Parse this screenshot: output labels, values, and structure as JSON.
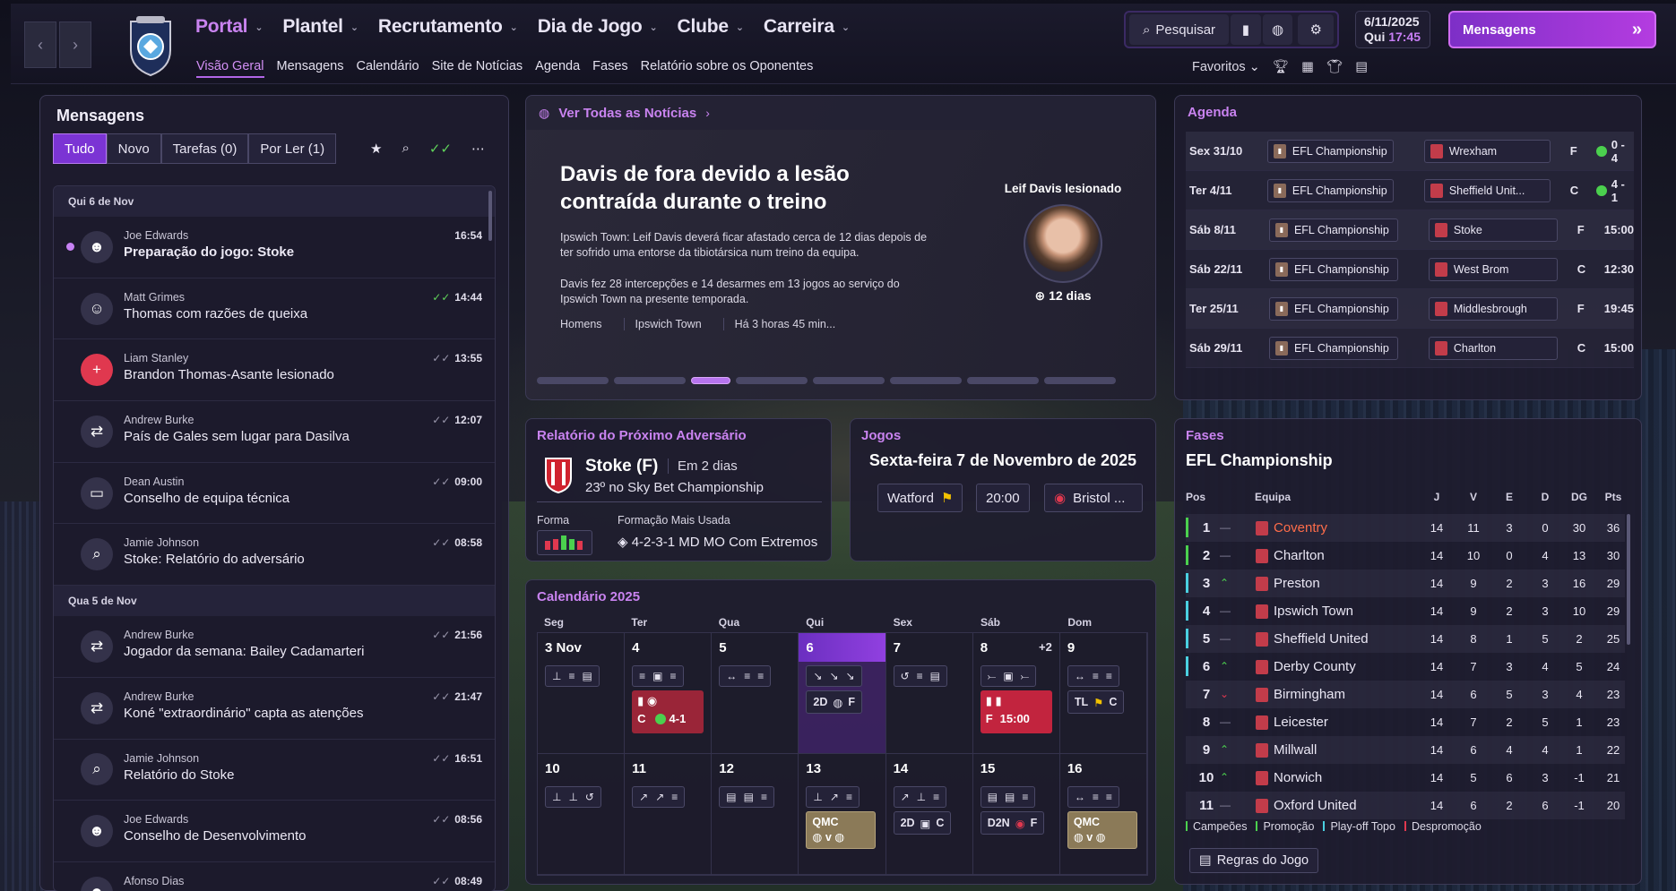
{
  "nav": {
    "back": "‹",
    "forward": "›"
  },
  "menu": [
    {
      "label": "Portal",
      "active": true
    },
    {
      "label": "Plantel"
    },
    {
      "label": "Recrutamento"
    },
    {
      "label": "Dia de Jogo"
    },
    {
      "label": "Clube"
    },
    {
      "label": "Carreira"
    }
  ],
  "submenu": [
    "Visão Geral",
    "Mensagens",
    "Calendário",
    "Site de Notícias",
    "Agenda",
    "Fases",
    "Relatório sobre os Oponentes"
  ],
  "tools": {
    "search": "Pesquisar"
  },
  "datetime": {
    "date": "6/11/2025",
    "day": "Qui",
    "time": "17:45"
  },
  "messages_button": "Mensagens",
  "favourites": "Favoritos",
  "inbox": {
    "title": "Mensagens",
    "filters": [
      "Tudo",
      "Novo",
      "Tarefas (0)",
      "Por Ler (1)"
    ],
    "groups": [
      {
        "date": "Qui 6 de Nov",
        "items": [
          {
            "from": "Joe Edwards",
            "subject": "Preparação do jogo: Stoke",
            "time": "16:54",
            "unread": true,
            "icon": "people-icon"
          },
          {
            "from": "Matt Grimes",
            "subject": "Thomas com razões de queixa",
            "time": "14:44",
            "read": "green",
            "icon": "player-photo"
          },
          {
            "from": "Liam Stanley",
            "subject": "Brandon Thomas-Asante lesionado",
            "time": "13:55",
            "icon": "medical-icon"
          },
          {
            "from": "Andrew Burke",
            "subject": "País de Gales sem lugar para Dasilva",
            "time": "12:07",
            "icon": "transfer-icon"
          },
          {
            "from": "Dean Austin",
            "subject": "Conselho de equipa técnica",
            "time": "09:00",
            "icon": "briefcase-icon"
          },
          {
            "from": "Jamie Johnson",
            "subject": "Stoke: Relatório do adversário",
            "time": "08:58",
            "icon": "scout-icon"
          }
        ]
      },
      {
        "date": "Qua 5 de Nov",
        "items": [
          {
            "from": "Andrew Burke",
            "subject": "Jogador da semana: Bailey Cadamarteri",
            "time": "21:56",
            "icon": "transfer-icon"
          },
          {
            "from": "Andrew Burke",
            "subject": "Koné \"extraordinário\" capta as atenções",
            "time": "21:47",
            "icon": "transfer-icon"
          },
          {
            "from": "Jamie Johnson",
            "subject": "Relatório do Stoke",
            "time": "16:51",
            "icon": "scout-icon"
          },
          {
            "from": "Joe Edwards",
            "subject": "Conselho de Desenvolvimento",
            "time": "08:56",
            "icon": "people-icon"
          },
          {
            "from": "Afonso Dias",
            "subject": "",
            "time": "08:49",
            "icon": "people-icon"
          }
        ]
      }
    ]
  },
  "news": {
    "link": "Ver Todas as Notícias",
    "headline": "Davis de fora devido a lesão contraída durante o treino",
    "p1": "Ipswich Town: Leif Davis deverá ficar afastado cerca de 12 dias depois de ter sofrido uma entorse da tibiotársica num treino da equipa.",
    "p2": "Davis fez 28 intercepções e 14 desarmes em 13 jogos ao serviço do Ipswich Town na presente temporada.",
    "tags": [
      "Homens",
      "Ipswich Town",
      "Há 3 horas 45 min..."
    ],
    "injury_title": "Leif Davis lesionado",
    "injury_days": "12 dias",
    "active_page": 3,
    "pages": 8
  },
  "agenda": {
    "title": "Agenda",
    "rows": [
      {
        "date": "Sex 31/10",
        "comp": "EFL Championship",
        "opp": "Wrexham",
        "ha": "F",
        "result": "0 - 4",
        "win": true
      },
      {
        "date": "Ter 4/11",
        "comp": "EFL Championship",
        "opp": "Sheffield Unit...",
        "ha": "C",
        "result": "4 - 1",
        "win": true
      },
      {
        "date": "Sáb 8/11",
        "comp": "EFL Championship",
        "opp": "Stoke",
        "ha": "F",
        "result": "15:00"
      },
      {
        "date": "Sáb 22/11",
        "comp": "EFL Championship",
        "opp": "West Brom",
        "ha": "C",
        "result": "12:30"
      },
      {
        "date": "Ter 25/11",
        "comp": "EFL Championship",
        "opp": "Middlesbrough",
        "ha": "F",
        "result": "19:45"
      },
      {
        "date": "Sáb 29/11",
        "comp": "EFL Championship",
        "opp": "Charlton",
        "ha": "C",
        "result": "15:00"
      }
    ]
  },
  "opponent": {
    "title": "Relatório do Próximo Adversário",
    "team": "Stoke (F)",
    "in": "Em 2 dias",
    "position": "23º no Sky Bet Championship",
    "form_label": "Forma",
    "formation_label": "Formação Mais Usada",
    "formation": "4-2-3-1 MD MO Com Extremos"
  },
  "jogos": {
    "title": "Jogos",
    "date": "Sexta-feira 7 de Novembro de 2025",
    "home": "Watford",
    "time": "20:00",
    "away": "Bristol ..."
  },
  "calendar": {
    "title": "Calendário 2025",
    "weekdays": [
      "Seg",
      "Ter",
      "Qua",
      "Qui",
      "Sex",
      "Sáb",
      "Dom"
    ],
    "week1": [
      "3 Nov",
      "4",
      "5",
      "6",
      "7",
      "8",
      "9"
    ],
    "week2": [
      "10",
      "11",
      "12",
      "13",
      "14",
      "15",
      "16"
    ],
    "extra": "+2",
    "tue_result": "4-1",
    "sat_time": "15:00",
    "sat_ha": "F",
    "tue_ha": "C",
    "thu_row": [
      "2D",
      "F"
    ],
    "sun_row": [
      "TL",
      "C"
    ],
    "fri2": [
      "2D",
      "C"
    ],
    "sat2": [
      "D2N",
      "F"
    ],
    "qmc": "QMC",
    "v": "v"
  },
  "fases": {
    "title": "Fases",
    "league": "EFL Championship",
    "cols": [
      "Pos",
      "Equipa",
      "J",
      "V",
      "E",
      "D",
      "DG",
      "Pts"
    ],
    "rows": [
      {
        "pos": "1",
        "mv": "—",
        "team": "Coventry",
        "j": 14,
        "v": 11,
        "e": 3,
        "d": 0,
        "dg": 30,
        "pts": 36,
        "zone": "champ",
        "hl": true
      },
      {
        "pos": "2",
        "mv": "—",
        "team": "Charlton",
        "j": 14,
        "v": 10,
        "e": 0,
        "d": 4,
        "dg": 13,
        "pts": 30,
        "zone": "promo"
      },
      {
        "pos": "3",
        "mv": "^",
        "team": "Preston",
        "j": 14,
        "v": 9,
        "e": 2,
        "d": 3,
        "dg": 16,
        "pts": 29,
        "zone": "playoff"
      },
      {
        "pos": "4",
        "mv": "—",
        "team": "Ipswich Town",
        "j": 14,
        "v": 9,
        "e": 2,
        "d": 3,
        "dg": 10,
        "pts": 29,
        "zone": "playoff"
      },
      {
        "pos": "5",
        "mv": "—",
        "team": "Sheffield United",
        "j": 14,
        "v": 8,
        "e": 1,
        "d": 5,
        "dg": 2,
        "pts": 25,
        "zone": "playoff"
      },
      {
        "pos": "6",
        "mv": "^",
        "team": "Derby County",
        "j": 14,
        "v": 7,
        "e": 3,
        "d": 4,
        "dg": 5,
        "pts": 24,
        "zone": "playoff"
      },
      {
        "pos": "7",
        "mv": "v",
        "team": "Birmingham",
        "j": 14,
        "v": 6,
        "e": 5,
        "d": 3,
        "dg": 4,
        "pts": 23
      },
      {
        "pos": "8",
        "mv": "—",
        "team": "Leicester",
        "j": 14,
        "v": 7,
        "e": 2,
        "d": 5,
        "dg": 1,
        "pts": 23
      },
      {
        "pos": "9",
        "mv": "^",
        "team": "Millwall",
        "j": 14,
        "v": 6,
        "e": 4,
        "d": 4,
        "dg": 1,
        "pts": 22
      },
      {
        "pos": "10",
        "mv": "^",
        "team": "Norwich",
        "j": 14,
        "v": 5,
        "e": 6,
        "d": 3,
        "dg": -1,
        "pts": 21
      },
      {
        "pos": "11",
        "mv": "—",
        "team": "Oxford United",
        "j": 14,
        "v": 6,
        "e": 2,
        "d": 6,
        "dg": -1,
        "pts": 20
      }
    ],
    "legend": [
      "Campeões",
      "Promoção",
      "Play-off Topo",
      "Despromoção"
    ],
    "rules": "Regras do Jogo"
  },
  "colors": {
    "accent": "#c983f0",
    "champ": "#4bd04e",
    "promo": "#4bd04e",
    "playoff": "#4ad0e0",
    "releg": "#e0384f"
  }
}
